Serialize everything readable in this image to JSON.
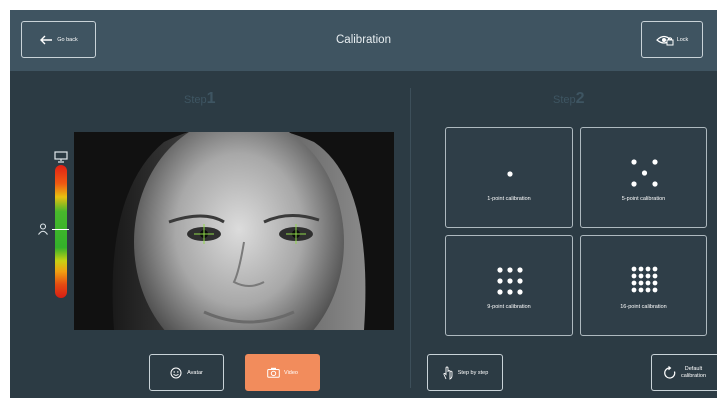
{
  "header": {
    "title": "Calibration",
    "back_label": "Go back",
    "lock_label": "Lock"
  },
  "step1": {
    "prefix": "Step",
    "number": "1"
  },
  "step2": {
    "prefix": "Step",
    "number": "2"
  },
  "calibrations": [
    {
      "label": "1-point calibration",
      "points": 1
    },
    {
      "label": "5-point calibration",
      "points": 5
    },
    {
      "label": "9-point calibration",
      "points": 9
    },
    {
      "label": "16-point calibration",
      "points": 16
    }
  ],
  "bottom": {
    "avatar_label": "Avatar",
    "video_label": "Video",
    "step_by_step_label": "Step by step",
    "default_label_line1": "Default",
    "default_label_line2": "calibration"
  },
  "colors": {
    "background": "#2c3b44",
    "header": "#3f5461",
    "accent": "#f28c5c",
    "crosshair": "#8fd84a"
  },
  "icons": [
    "arrow-left-icon",
    "eye-lock-icon",
    "monitor-icon",
    "person-icon",
    "smiley-icon",
    "camera-icon",
    "hand-pointer-icon",
    "rotate-icon"
  ]
}
